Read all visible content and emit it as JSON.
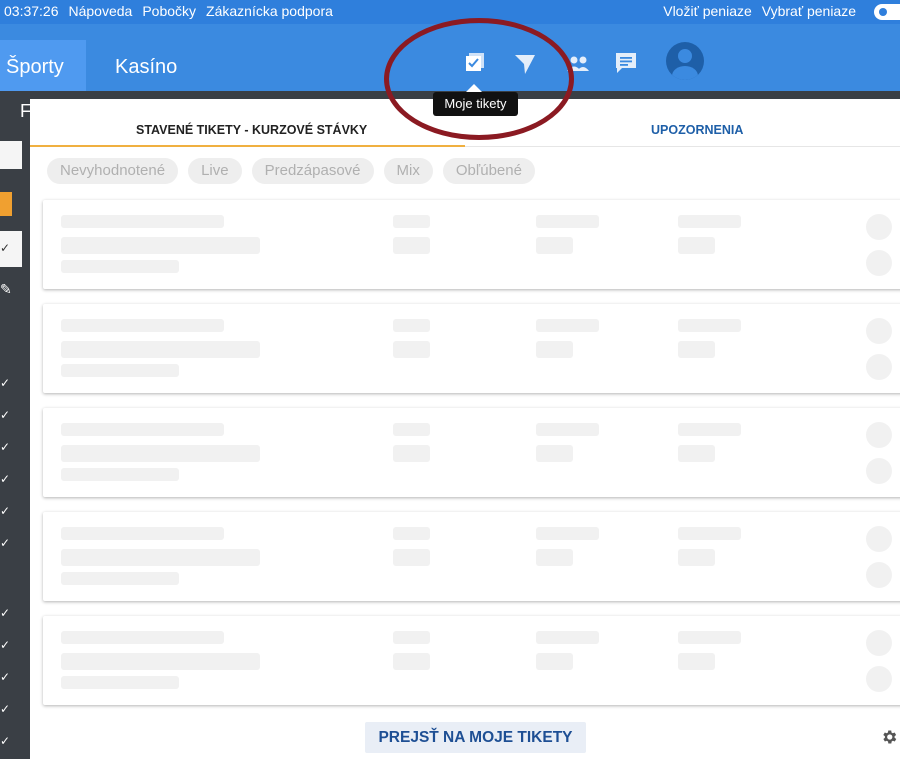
{
  "topbar": {
    "time": "03:37:26",
    "links": [
      "Nápoveda",
      "Pobočky",
      "Zákaznícka podpora"
    ],
    "actions": [
      "Vložiť peniaze",
      "Vybrať peniaze"
    ]
  },
  "nav": {
    "tabs": [
      "Športy",
      "Kasíno"
    ],
    "icons": [
      "tickets-icon",
      "send-icon",
      "group-icon",
      "chat-icon",
      "avatar-icon"
    ],
    "tooltip": "Moje tikety"
  },
  "sidebar": {
    "letter": "F"
  },
  "panel": {
    "tabs": [
      "STAVENÉ TIKETY - KURZOVÉ STÁVKY",
      "UPOZORNENIA"
    ],
    "filters": [
      "Nevyhodnotené",
      "Live",
      "Predzápasové",
      "Mix",
      "Obľúbené"
    ],
    "footer_button": "PREJSŤ NA MOJE TIKETY",
    "settings_icon": "gear-icon"
  },
  "colors": {
    "topbar": "#2f7fdc",
    "navbar": "#3b8ae0",
    "accent": "#f0b040",
    "annotation": "#8b1a22"
  }
}
